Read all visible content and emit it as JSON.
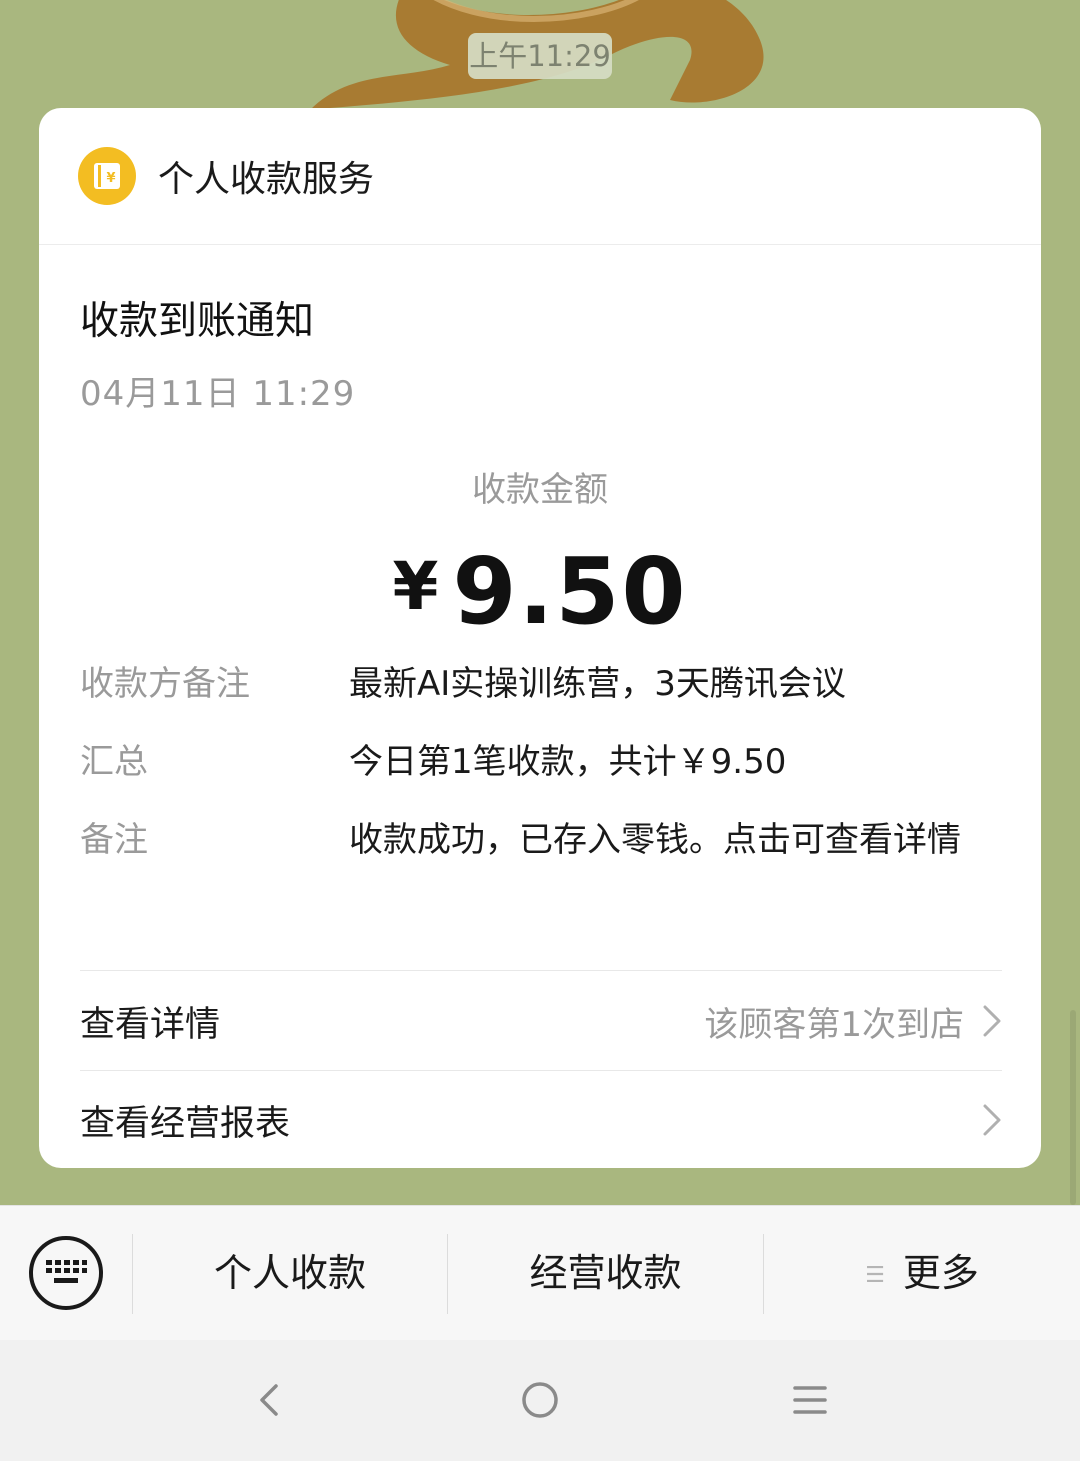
{
  "chat": {
    "timestamp": "上午11:29"
  },
  "card": {
    "service_name": "个人收款服务",
    "service_icon": "wallet-yen-icon",
    "title": "收款到账通知",
    "datetime": "04月11日 11:29",
    "amount_label": "收款金额",
    "amount_currency": "¥",
    "amount_value": "9.50",
    "rows": [
      {
        "label": "收款方备注",
        "value": "最新AI实操训练营，3天腾讯会议"
      },
      {
        "label": "汇总",
        "value": "今日第1笔收款，共计￥9.50"
      },
      {
        "label": "备注",
        "value": "收款成功，已存入零钱。点击可查看详情"
      }
    ],
    "links": [
      {
        "label": "查看详情",
        "hint": "该顾客第1次到店"
      },
      {
        "label": "查看经营报表",
        "hint": ""
      }
    ]
  },
  "menu": {
    "keyboard_icon": "keyboard-icon",
    "items": [
      "个人收款",
      "经营收款",
      "更多"
    ],
    "more_icon": "list-icon"
  },
  "nav": {
    "back_icon": "back-icon",
    "home_icon": "home-icon",
    "menu_icon": "menu-icon"
  },
  "colors": {
    "chat_background": "#a9b77f",
    "service_icon": "#f3bd22",
    "secondary_text": "#9a9a9a"
  }
}
